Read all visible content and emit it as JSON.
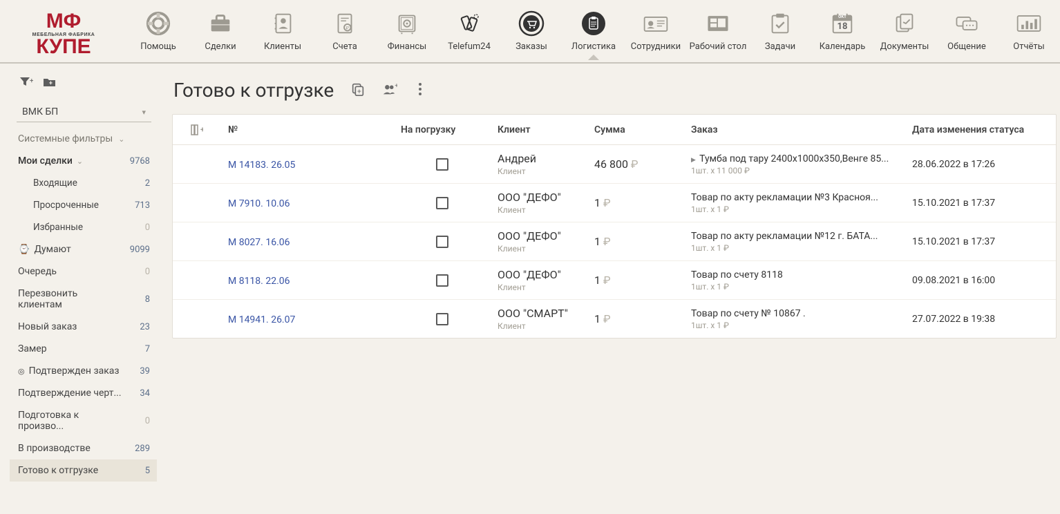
{
  "logo": {
    "top": "МФ",
    "sub": "МЕБЕЛЬНАЯ ФАБРИКА",
    "bottom": "КУПЕ"
  },
  "nav": [
    {
      "label": "Помощь"
    },
    {
      "label": "Сделки"
    },
    {
      "label": "Клиенты"
    },
    {
      "label": "Счета"
    },
    {
      "label": "Финансы"
    },
    {
      "label": "Telefum24"
    },
    {
      "label": "Заказы"
    },
    {
      "label": "Логистика",
      "active": true
    },
    {
      "label": "Сотрудники"
    },
    {
      "label": "Рабочий стол"
    },
    {
      "label": "Задачи"
    },
    {
      "label": "Календарь",
      "cal_month": "ОКТ",
      "cal_day": "18"
    },
    {
      "label": "Документы"
    },
    {
      "label": "Общение"
    },
    {
      "label": "Отчёты"
    }
  ],
  "sidebar": {
    "dropdown_label": "ВМК БП",
    "filters_label": "Системные фильтры",
    "my_deals": {
      "label": "Мои сделки",
      "count": "9768"
    },
    "sub_items": [
      {
        "label": "Входящие",
        "count": "2"
      },
      {
        "label": "Просроченные",
        "count": "713"
      },
      {
        "label": "Избранные",
        "count": "0"
      }
    ],
    "stages": [
      {
        "label": "Думают",
        "count": "9099",
        "icon": true
      },
      {
        "label": "Очередь",
        "count": "0"
      },
      {
        "label": "Перезвонить клиентам",
        "count": "8"
      },
      {
        "label": "Новый заказ",
        "count": "23"
      },
      {
        "label": "Замер",
        "count": "7"
      },
      {
        "label": "Подтвержден заказ",
        "count": "39",
        "icon": true
      },
      {
        "label": "Подтверждение черт...",
        "count": "34"
      },
      {
        "label": "Подготовка к произво...",
        "count": "0"
      },
      {
        "label": "В производстве",
        "count": "289"
      },
      {
        "label": "Готово к отгрузке",
        "count": "5",
        "active": true
      }
    ]
  },
  "page": {
    "title": "Готово к отгрузке"
  },
  "table": {
    "headers": {
      "num": "№",
      "loading": "На погрузку",
      "client": "Клиент",
      "sum": "Сумма",
      "order": "Заказ",
      "status_date": "Дата изменения статуса"
    },
    "client_sub": "Клиент",
    "rows": [
      {
        "num": "М 14183. 26.05",
        "client": "Андрей",
        "sum": "46 800",
        "order_title": "Тумба под тару 2400х1000х350,Венге 85...",
        "order_qty": "1шт. x 11 000 ₽",
        "date": "28.06.2022 в 17:26",
        "caret": true
      },
      {
        "num": "М 7910. 10.06",
        "client": "ООО \"ДЕФО\"",
        "sum": "1",
        "order_title": "Товар по акту рекламации №3 Красноя...",
        "order_qty": "1шт. x 1 ₽",
        "date": "15.10.2021 в 17:37"
      },
      {
        "num": "М 8027. 16.06",
        "client": "ООО \"ДЕФО\"",
        "sum": "1",
        "order_title": "Товар по акту рекламации №12 г. БАТА...",
        "order_qty": "1шт. x 1 ₽",
        "date": "15.10.2021 в 17:37"
      },
      {
        "num": "М 8118. 22.06",
        "client": "ООО \"ДЕФО\"",
        "sum": "1",
        "order_title": "Товар по счету 8118",
        "order_qty": "1шт. x 1 ₽",
        "date": "09.08.2021 в 16:00"
      },
      {
        "num": "М 14941. 26.07",
        "client": "ООО \"СМАРТ\"",
        "sum": "1",
        "order_title": "Товар по счету № 10867 .",
        "order_qty": "1шт. x 1 ₽",
        "date": "27.07.2022 в 19:38"
      }
    ]
  }
}
